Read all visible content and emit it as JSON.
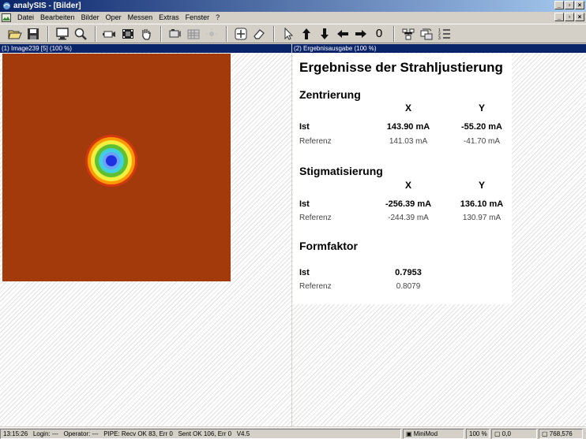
{
  "window": {
    "title": "analySIS - [Bilder]"
  },
  "menu": {
    "items": [
      "Datei",
      "Bearbeiten",
      "Bilder",
      "Oper",
      "Messen",
      "Extras",
      "Fenster",
      "?"
    ]
  },
  "toolbar": {
    "counter_label": "0"
  },
  "image_pane": {
    "title": "(1) Image239 [5] (100 %)"
  },
  "results_pane": {
    "title": "(2) Ergebnisausgabe (100 %)",
    "heading": "Ergebnisse der Strahljustierung",
    "col_x": "X",
    "col_y": "Y",
    "ist_label": "Ist",
    "ref_label": "Referenz",
    "zentrierung": {
      "title": "Zentrierung",
      "ist_x": "143.90 mA",
      "ist_y": "-55.20 mA",
      "ref_x": "141.03 mA",
      "ref_y": "-41.70 mA"
    },
    "stigmatisierung": {
      "title": "Stigmatisierung",
      "ist_x": "-256.39 mA",
      "ist_y": "136.10 mA",
      "ref_x": "-244.39 mA",
      "ref_y": "130.97 mA"
    },
    "formfaktor": {
      "title": "Formfaktor",
      "ist": "0.7953",
      "ref": "0.8079"
    }
  },
  "statusbar": {
    "time": "13:15:26",
    "login": "Login: ---",
    "operator": "Operator: ---",
    "pipe": "PIPE: Recv OK 83, Err 0",
    "sent": "Sent OK 106, Err 0",
    "version": "V4.5",
    "camera": "MiniMod",
    "zoom": "100 %",
    "coord1": "0,0",
    "coord2": "768,576"
  },
  "colors": {
    "image_bg": "#a33a0c",
    "title_bar": "#0a246a"
  }
}
